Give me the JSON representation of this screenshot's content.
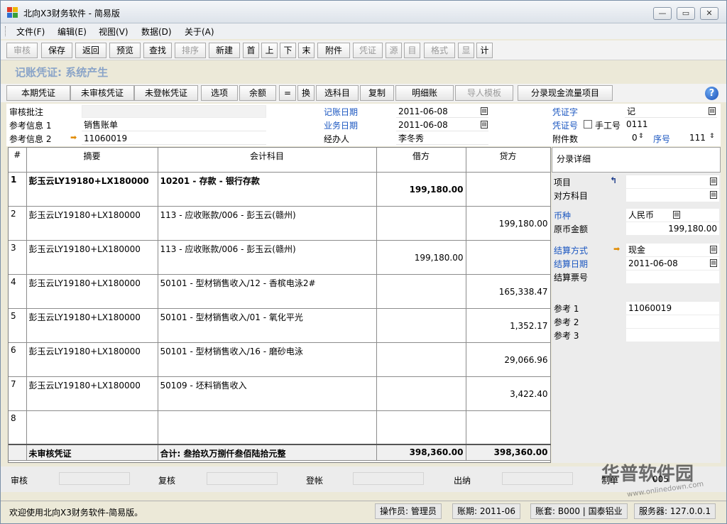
{
  "window": {
    "title": "北向X3财务软件 - 简易版",
    "controls": {
      "minimize": "—",
      "restore": "▭",
      "close": "✕"
    }
  },
  "menu": [
    "文件(F)",
    "编辑(E)",
    "视图(V)",
    "数据(D)",
    "关于(A)"
  ],
  "toolbar": [
    {
      "label": "审核",
      "enabled": false
    },
    {
      "label": "保存",
      "enabled": true
    },
    {
      "label": "返回",
      "enabled": true
    },
    {
      "label": "预览",
      "enabled": true
    },
    {
      "label": "查找",
      "enabled": true
    },
    {
      "label": "排序",
      "enabled": false
    },
    {
      "label": "新建",
      "enabled": true
    },
    {
      "label": "首",
      "enabled": true
    },
    {
      "label": "上",
      "enabled": true
    },
    {
      "label": "下",
      "enabled": true
    },
    {
      "label": "末",
      "enabled": true
    },
    {
      "label": "附件",
      "enabled": true
    },
    {
      "label": "凭证",
      "enabled": false
    },
    {
      "label": "源",
      "enabled": false
    },
    {
      "label": "目",
      "enabled": false
    },
    {
      "label": "格式",
      "enabled": false
    },
    {
      "label": "显",
      "enabled": false
    },
    {
      "label": "计",
      "enabled": true
    }
  ],
  "voucher_heading": "记账凭证: 系统产生",
  "toolbar2": [
    {
      "label": "本期凭证",
      "enabled": true
    },
    {
      "label": "未审核凭证",
      "enabled": true
    },
    {
      "label": "未登帐凭证",
      "enabled": true
    },
    {
      "label": "选项",
      "enabled": true
    },
    {
      "label": "余额",
      "enabled": true
    },
    {
      "label": "=",
      "enabled": true
    },
    {
      "label": "换",
      "enabled": true
    },
    {
      "label": "选科目",
      "enabled": true
    },
    {
      "label": "复制",
      "enabled": true
    },
    {
      "label": "明细账",
      "enabled": true
    },
    {
      "label": "导人模板",
      "enabled": false
    },
    {
      "label": "分录现金流量项目",
      "enabled": true
    }
  ],
  "help_label": "?",
  "form": {
    "audit_note_label": "审核批注",
    "audit_note_value": "",
    "ref1_label": "参考信息 1",
    "ref1_value": "销售账单",
    "ref2_label": "参考信息 2",
    "ref2_value": "11060019",
    "post_date_label": "记账日期",
    "post_date_value": "2011-06-08",
    "biz_date_label": "业务日期",
    "biz_date_value": "2011-06-08",
    "handler_label": "经办人",
    "handler_value": "李冬秀",
    "voucher_word_label": "凭证字",
    "voucher_word_value": "记",
    "voucher_no_label": "凭证号",
    "manual_no_label": "手工号",
    "voucher_no_value": "0111",
    "attachments_label": "附件数",
    "attachments_value": "0",
    "seq_label": "序号",
    "seq_value": "111"
  },
  "grid": {
    "headers": [
      "#",
      "摘要",
      "会计科目",
      "借方",
      "贷方"
    ],
    "rows": [
      {
        "no": "1",
        "summary": "彭玉云LY19180+LX180000",
        "account": "10201 - 存款 - 银行存款",
        "debit": "199,180.00",
        "credit": ""
      },
      {
        "no": "2",
        "summary": "彭玉云LY19180+LX180000",
        "account": "113 - 应收账款/006 - 彭玉云(赣州)",
        "debit": "",
        "credit": "199,180.00"
      },
      {
        "no": "3",
        "summary": "彭玉云LY19180+LX180000",
        "account": "113 - 应收账款/006 - 彭玉云(赣州)",
        "debit": "199,180.00",
        "credit": ""
      },
      {
        "no": "4",
        "summary": "彭玉云LY19180+LX180000",
        "account": "50101 - 型材销售收入/12 - 香槟电泳2#",
        "debit": "",
        "credit": "165,338.47"
      },
      {
        "no": "5",
        "summary": "彭玉云LY19180+LX180000",
        "account": "50101 - 型材销售收入/01 - 氧化平光",
        "debit": "",
        "credit": "1,352.17"
      },
      {
        "no": "6",
        "summary": "彭玉云LY19180+LX180000",
        "account": "50101 - 型材销售收入/16 - 磨砂电泳",
        "debit": "",
        "credit": "29,066.96"
      },
      {
        "no": "7",
        "summary": "彭玉云LY19180+LX180000",
        "account": "50109 - 坯料销售收入",
        "debit": "",
        "credit": "3,422.40"
      },
      {
        "no": "8",
        "summary": "",
        "account": "",
        "debit": "",
        "credit": ""
      }
    ],
    "total": {
      "status": "未审核凭证",
      "caption": "合计: 叁拾玖万捌仟叁佰陆拾元整",
      "debit": "398,360.00",
      "credit": "398,360.00"
    }
  },
  "detail": {
    "header": "分录详细",
    "item_label": "项目",
    "contra_label": "对方科目",
    "currency_label": "币种",
    "currency_value": "人民币",
    "orig_amount_label": "原币金额",
    "orig_amount_value": "199,180.00",
    "settle_method_label": "结算方式",
    "settle_method_value": "现金",
    "settle_date_label": "结算日期",
    "settle_date_value": "2011-06-08",
    "settle_no_label": "结算票号",
    "ref1_label": "参考 1",
    "ref1_value": "11060019",
    "ref2_label": "参考 2",
    "ref3_label": "参考 3"
  },
  "bottom": {
    "auditor_label": "审核",
    "reviewer_label": "复核",
    "poster_label": "登帐",
    "cashier_label": "出纳",
    "maker_label": "制单",
    "maker_value": "005"
  },
  "status": {
    "message": "欢迎使用北向X3财务软件-简易版。",
    "operator": "操作员: 管理员",
    "period": "账期: 2011-06",
    "account_set": "账套: B000 | 国泰铝业",
    "server": "服务器: 127.0.0.1"
  },
  "watermark": {
    "text": "华普软件园",
    "url": "www.onlinedown.com"
  },
  "icons": {
    "app": "app-logo-icon",
    "calendar": "calendar-icon",
    "arrow": "arrow-right-icon",
    "help": "help-icon"
  },
  "colors": {
    "blue_label": "#1a56c0",
    "heading": "#8aa4c8",
    "arrow": "#e08a00"
  }
}
